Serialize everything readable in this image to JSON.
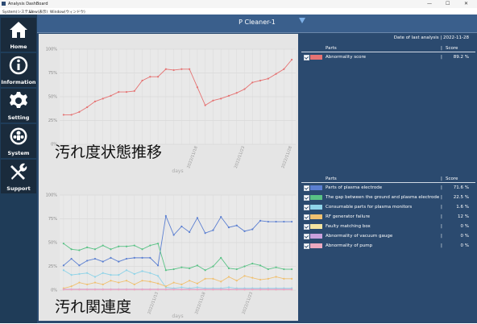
{
  "window": {
    "title": "Analysis DashBoard",
    "min": "—",
    "max": "☐",
    "close": "✕"
  },
  "menu": {
    "items": [
      "System(システム)",
      "View(表示)",
      "Window(ウィンドウ)"
    ]
  },
  "nav": {
    "items": [
      {
        "label": "Home",
        "icon": "home-icon"
      },
      {
        "label": "Information",
        "icon": "info-icon"
      },
      {
        "label": "Setting",
        "icon": "gear-icon"
      },
      {
        "label": "System",
        "icon": "system-icon"
      },
      {
        "label": "Support",
        "icon": "wrench-icon"
      }
    ]
  },
  "header": {
    "title": "P Cleaner-1"
  },
  "charts": {
    "top_caption": "汚れ度状態推移",
    "bottom_caption": "汚れ関連度"
  },
  "chart_data": [
    {
      "type": "line",
      "xlabel": "days",
      "x": [
        "",
        "",
        "",
        "",
        "",
        "",
        "",
        "",
        "",
        "",
        "",
        "",
        "",
        "",
        "",
        "",
        "",
        "2022/11/18",
        "",
        "",
        "",
        "",
        "",
        "2022/11/23",
        "",
        "",
        "",
        "",
        "",
        "2022/11/28"
      ],
      "ylim": [
        0,
        100
      ],
      "yticks": [
        "0%",
        "25%",
        "50%",
        "75%",
        "100%"
      ],
      "series": [
        {
          "color": "#e57373",
          "values": [
            31,
            31,
            34,
            39,
            45,
            48,
            51,
            55,
            55,
            56,
            67,
            71,
            71,
            79,
            78,
            79,
            79,
            60,
            41,
            46,
            48,
            51,
            54,
            58,
            65,
            67,
            69,
            74,
            79,
            89
          ]
        }
      ]
    },
    {
      "type": "line",
      "xlabel": "days",
      "x": [
        "",
        "",
        "",
        "",
        "",
        "",
        "",
        "",
        "",
        "",
        "",
        "",
        "2022/11/13",
        "",
        "",
        "",
        "",
        "",
        "2022/11/18",
        "",
        "",
        "",
        "",
        "",
        "2022/11/23",
        "",
        "",
        "",
        "",
        ""
      ],
      "ylim": [
        0,
        100
      ],
      "yticks": [
        "0%",
        "25%",
        "50%",
        "75%",
        "100%"
      ],
      "series": [
        {
          "color": "#5b7fd1",
          "values": [
            26,
            33,
            26,
            31,
            33,
            30,
            34,
            30,
            33,
            34,
            34,
            34,
            26,
            78,
            58,
            67,
            61,
            76,
            60,
            63,
            77,
            66,
            68,
            62,
            64,
            73,
            72,
            72,
            72,
            72
          ]
        },
        {
          "color": "#59c285",
          "values": [
            49,
            43,
            42,
            45,
            43,
            47,
            43,
            46,
            46,
            47,
            43,
            47,
            49,
            21,
            22,
            24,
            23,
            26,
            21,
            25,
            34,
            23,
            22,
            25,
            28,
            26,
            22,
            24,
            22,
            22
          ]
        },
        {
          "color": "#8fd3e8",
          "values": [
            21,
            16,
            17,
            18,
            14,
            18,
            16,
            16,
            21,
            17,
            20,
            18,
            15,
            3,
            2,
            3,
            2,
            3,
            2,
            2,
            2,
            3,
            2,
            2,
            2,
            2,
            2,
            2,
            2,
            2
          ]
        },
        {
          "color": "#f0c070",
          "values": [
            2,
            4,
            8,
            6,
            8,
            6,
            10,
            8,
            10,
            6,
            10,
            9,
            7,
            4,
            8,
            6,
            10,
            7,
            12,
            12,
            9,
            14,
            10,
            15,
            13,
            11,
            12,
            14,
            12,
            12
          ]
        },
        {
          "color": "#f3e3a0",
          "values": [
            1,
            1,
            1,
            1,
            1,
            1,
            1,
            1,
            1,
            1,
            1,
            1,
            1,
            1,
            1,
            1,
            1,
            1,
            1,
            1,
            1,
            1,
            1,
            1,
            1,
            1,
            1,
            1,
            1,
            1
          ]
        },
        {
          "color": "#c9a0dc",
          "values": [
            1,
            1,
            1,
            1,
            1,
            1,
            1,
            1,
            1,
            1,
            1,
            1,
            1,
            1,
            1,
            1,
            1,
            1,
            1,
            1,
            1,
            1,
            1,
            1,
            1,
            1,
            1,
            1,
            1,
            1
          ]
        },
        {
          "color": "#eda9c0",
          "values": [
            0.5,
            0.5,
            0.5,
            0.5,
            0.5,
            0.5,
            0.5,
            0.5,
            0.5,
            0.5,
            0.5,
            0.5,
            0.5,
            0.5,
            0.5,
            0.5,
            0.5,
            0.5,
            0.5,
            0.5,
            0.5,
            0.5,
            0.5,
            0.5,
            0.5,
            0.5,
            0.5,
            0.5,
            0.5,
            0.5
          ]
        }
      ]
    }
  ],
  "top_table": {
    "date_label": "Date of last analysis | 2022-11-28",
    "col_parts": "Parts",
    "col_sep": "|",
    "col_score": "Score",
    "rows": [
      {
        "name": "Abnormality score",
        "sep": "|",
        "score": "89.2 %",
        "swatch": "#e57373",
        "checked": true
      }
    ]
  },
  "bottom_table": {
    "col_parts": "Parts",
    "col_sep": "|",
    "col_score": "Score",
    "rows": [
      {
        "name": "Parts of plasma electrode",
        "sep": "|",
        "score": "71.6 %",
        "swatch": "#5b7fd1"
      },
      {
        "name": "The gap between the ground and plasma electrode",
        "sep": "|",
        "score": "22.5 %",
        "swatch": "#59c285"
      },
      {
        "name": "Consumable parts for plasma monitors",
        "sep": "|",
        "score": "1.6 %",
        "swatch": "#8fd3e8"
      },
      {
        "name": "RF generator failure",
        "sep": "|",
        "score": "12 %",
        "swatch": "#f0c070"
      },
      {
        "name": "Faulty matching box",
        "sep": "|",
        "score": "0 %",
        "swatch": "#f3e3a0"
      },
      {
        "name": "Abnormality of vacuum gauge",
        "sep": "|",
        "score": "0 %",
        "swatch": "#c9a0dc"
      },
      {
        "name": "Abnormality of pump",
        "sep": "|",
        "score": "0 %",
        "swatch": "#eda9c0"
      }
    ]
  }
}
